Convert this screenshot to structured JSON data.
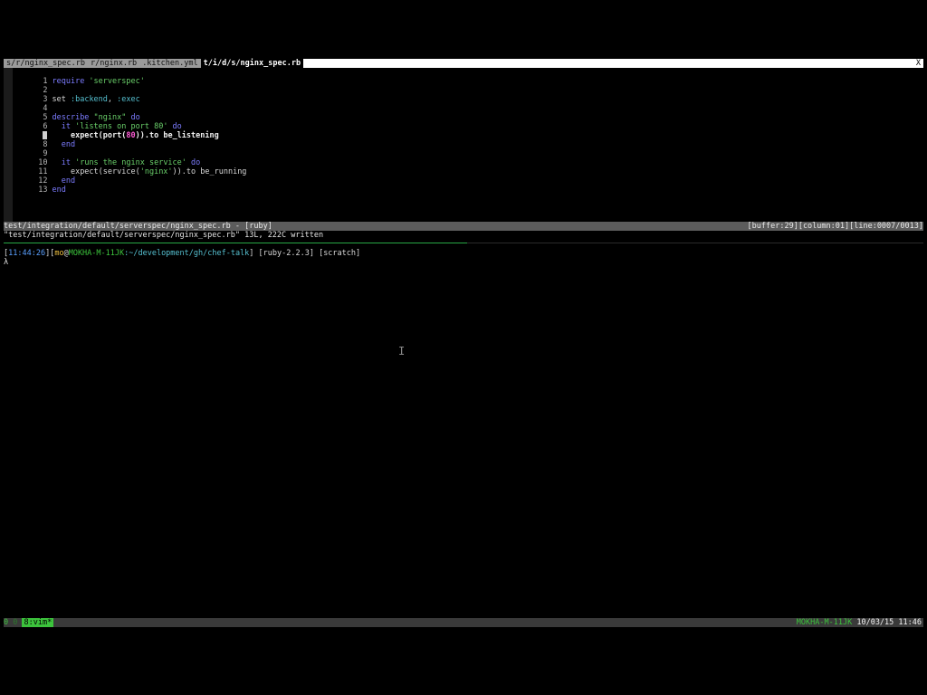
{
  "tabs": [
    {
      "label": "s/r/nginx_spec.rb"
    },
    {
      "label": "r/nginx.rb"
    },
    {
      "label": ".kitchen.yml"
    },
    {
      "label": "t/i/d/s/nginx_spec.rb"
    }
  ],
  "tab_close": "X",
  "code": {
    "l1": {
      "n": "1",
      "a": "require",
      "b": " 'serverspec'"
    },
    "l3": {
      "n": "3",
      "a": "set ",
      "b": ":backend",
      "c": ", ",
      "d": ":exec"
    },
    "l5": {
      "n": "5",
      "a": "describe",
      "b": " \"nginx\"",
      "c": " do"
    },
    "l6": {
      "n": "6",
      "a": "  it",
      "b": " 'listens on port 80'",
      "c": " do"
    },
    "l7": {
      "n": "7",
      "a": "    expect(port(",
      "b": "80",
      "c": ")).to be_listening"
    },
    "l8": {
      "n": "8",
      "a": "  end"
    },
    "l10": {
      "n": "10",
      "a": "  it",
      "b": " 'runs the nginx service'",
      "c": " do"
    },
    "l11": {
      "n": "11",
      "a": "    expect(service(",
      "b": "'nginx'",
      "c": ")).to be_running"
    },
    "l12": {
      "n": "12",
      "a": "  end"
    },
    "l13": {
      "n": "13",
      "a": "end"
    },
    "empty": {
      "n2": "2",
      "n4": "4",
      "n9": "9"
    }
  },
  "statusline": {
    "left": "test/integration/default/serverspec/nginx_spec.rb - [ruby]",
    "right": "[buffer:29][column:01][line:0007/0013]"
  },
  "cmdline": "\"test/integration/default/serverspec/nginx_spec.rb\" 13L, 222C written",
  "prompt": {
    "time": "11:44:26",
    "user": "mo",
    "at": "@",
    "host": "MOKHA-M-11JK",
    "path": ":~/development/gh/chef-talk",
    "ruby": " [ruby-2.2.3]",
    "branch": " [scratch]"
  },
  "caret": "λ",
  "ibeam": "I",
  "tmux": {
    "session": "0",
    "win0": " 0 ",
    "active_window": "8:vim*",
    "host": "MOKHA-M-11JK",
    "datetime": "10/03/15 11:46"
  }
}
